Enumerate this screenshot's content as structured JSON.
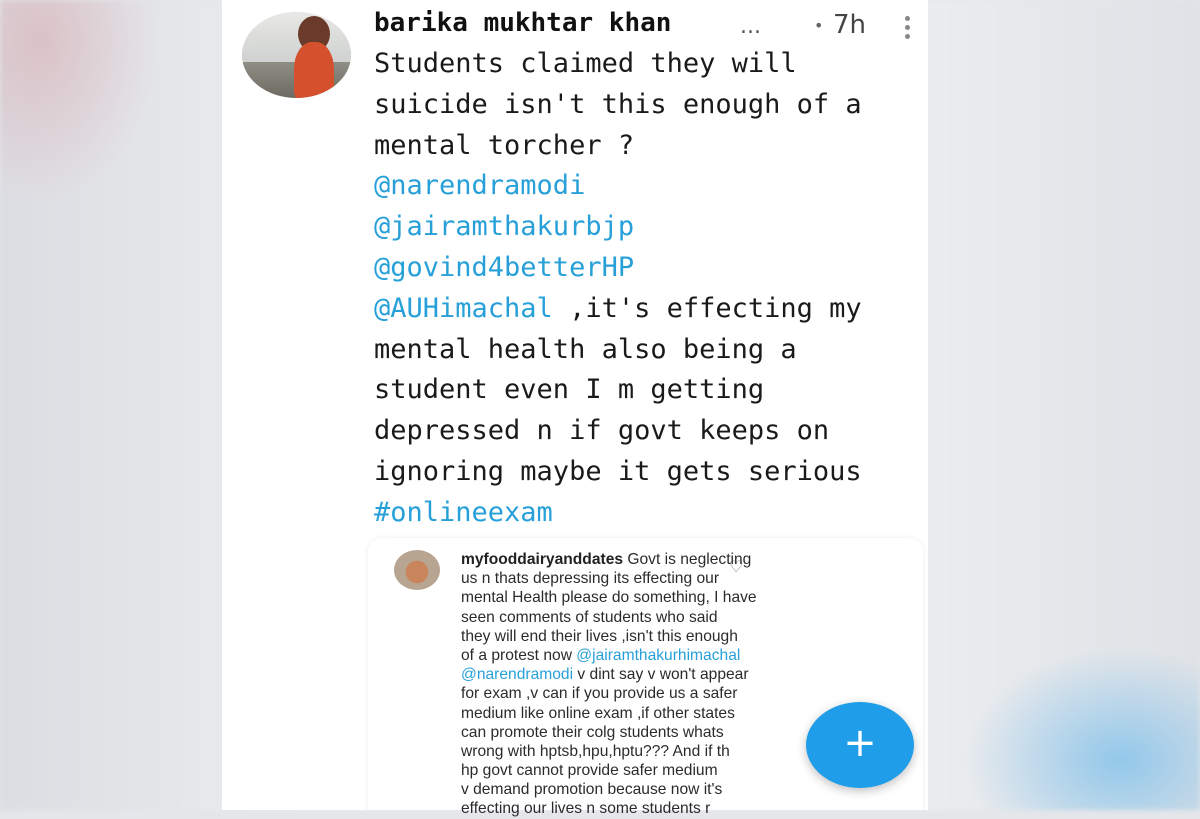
{
  "post": {
    "author": "barika mukhtar khan",
    "author_more": "...",
    "separator": "•",
    "time": "7h",
    "lines": [
      [
        {
          "t": "Students claimed they will",
          "k": "text"
        }
      ],
      [
        {
          "t": "suicide isn't this enough of a",
          "k": "text"
        }
      ],
      [
        {
          "t": "mental torcher ?",
          "k": "text"
        }
      ],
      [
        {
          "t": "@narendramodi",
          "k": "mention"
        }
      ],
      [
        {
          "t": "@jairamthakurbjp",
          "k": "mention"
        }
      ],
      [
        {
          "t": "@govind4betterHP",
          "k": "mention"
        }
      ],
      [
        {
          "t": "@AUHimachal",
          "k": "mention"
        },
        {
          "t": " ,it's effecting my",
          "k": "text"
        }
      ],
      [
        {
          "t": "mental health also being a",
          "k": "text"
        }
      ],
      [
        {
          "t": "student even I m getting",
          "k": "text"
        }
      ],
      [
        {
          "t": "depressed n if govt keeps on",
          "k": "text"
        }
      ],
      [
        {
          "t": "ignoring maybe it gets serious",
          "k": "text"
        }
      ],
      [
        {
          "t": "#onlineexam",
          "k": "hashtag"
        }
      ]
    ]
  },
  "comment": {
    "lines": [
      [
        {
          "t": "myfooddairyanddates",
          "k": "user"
        },
        {
          "t": " Govt is neglecting",
          "k": "text"
        }
      ],
      [
        {
          "t": "us n thats depressing its effecting our",
          "k": "text"
        }
      ],
      [
        {
          "t": "mental Health please do something, I have",
          "k": "text"
        }
      ],
      [
        {
          "t": "seen comments of students who said",
          "k": "text"
        }
      ],
      [
        {
          "t": "they will end their lives ,isn't this enough",
          "k": "text"
        }
      ],
      [
        {
          "t": "of a protest now ",
          "k": "text"
        },
        {
          "t": "@jairamthakurhimachal",
          "k": "mention"
        }
      ],
      [
        {
          "t": "@narendramodi",
          "k": "mention"
        },
        {
          "t": "  v dint say v won't appear",
          "k": "text"
        }
      ],
      [
        {
          "t": "for exam ,v can if you provide us a safer",
          "k": "text"
        }
      ],
      [
        {
          "t": "medium like online exam ,if other states",
          "k": "text"
        }
      ],
      [
        {
          "t": "can promote their colg students whats",
          "k": "text"
        }
      ],
      [
        {
          "t": "wrong with hptsb,hpu,hptu??? And if th",
          "k": "text"
        }
      ],
      [
        {
          "t": "hp govt cannot provide safer medium",
          "k": "text"
        }
      ],
      [
        {
          "t": "v demand promotion because now it's",
          "k": "text"
        }
      ],
      [
        {
          "t": "effecting our lives n some students r",
          "k": "text"
        }
      ]
    ]
  },
  "fab": {
    "label": "+"
  },
  "icons": {
    "menu": "vertical-dots-icon",
    "heart": "heart-outline-icon",
    "fab": "plus-icon"
  },
  "colors": {
    "link": "#27a0d9",
    "fab": "#1f9de8"
  }
}
